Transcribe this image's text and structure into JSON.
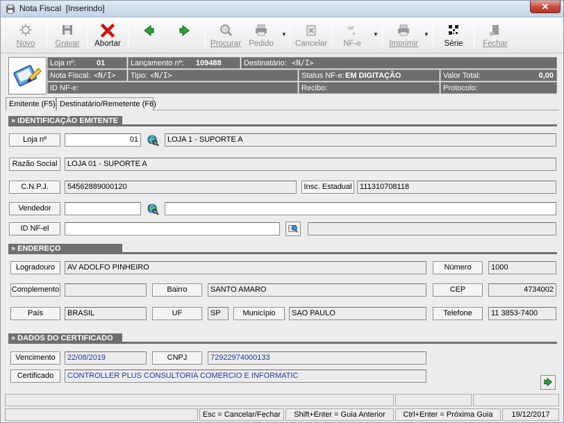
{
  "window": {
    "title": "Nota Fiscal",
    "mode": "[Inserindo]",
    "close_label": "✕"
  },
  "toolbar": {
    "novo": "Novo",
    "gravar": "Gravar",
    "abortar": "Abortar",
    "procurar": "Procurar",
    "pedido": "Pedido",
    "cancelar": "Cancelar",
    "nfe": "NF-e",
    "imprimir": "Imprimir",
    "serie": "Série",
    "fechar": "Fechar"
  },
  "header": {
    "loja_label": "Loja nº:",
    "loja_value": "01",
    "lancamento_label": "Lançamento nº:",
    "lancamento_value": "109488",
    "destinatario_label": "Destinatário:",
    "destinatario_value": "<N/I>",
    "nota_fiscal_label": "Nota Fiscal:",
    "nota_fiscal_value": "<N/I>",
    "tipo_label": "Tipo:",
    "tipo_value": "<N/I>",
    "status_label": "Status NF-e:",
    "status_value": "EM DIGITAÇÃO",
    "valor_total_label": "Valor Total:",
    "valor_total_value": "0,00",
    "id_nfe_label": "ID NF-e:",
    "recibo_label": "Recibo:",
    "protocolo_label": "Protocolo:"
  },
  "tabs": [
    {
      "label": "Emitente (F5)"
    },
    {
      "label": "Destinatário/Remetente (F6)"
    }
  ],
  "emitente": {
    "section_title": "» IDENTIFICAÇÃO EMITENTE",
    "loja_label": "Loja nº",
    "loja_value": "01",
    "loja_desc": "LOJA 1 - SUPORTE A",
    "razao_label": "Razão Social",
    "razao_value": "LOJA 01 - SUPORTE A",
    "cnpj_label": "C.N.P.J.",
    "cnpj_value": "54562889000120",
    "ie_label": "Insc. Estadual",
    "ie_value": "111310708118",
    "vendedor_label": "Vendedor",
    "vendedor_value": "",
    "vendedor_desc": "",
    "idnfe_label": "ID NF-el",
    "idnfe_value": "",
    "idnfe_desc": ""
  },
  "endereco": {
    "section_title": "» ENDEREÇO",
    "logradouro_label": "Logradouro",
    "logradouro_value": "AV ADOLFO PINHEIRO",
    "numero_label": "Número",
    "numero_value": "1000",
    "complemento_label": "Complemento",
    "complemento_value": "",
    "bairro_label": "Bairro",
    "bairro_value": "SANTO AMARO",
    "cep_label": "CEP",
    "cep_value": "4734002",
    "pais_label": "País",
    "pais_value": "BRASIL",
    "uf_label": "UF",
    "uf_value": "SP",
    "municipio_label": "Município",
    "municipio_value": "SAO PAULO",
    "telefone_label": "Telefone",
    "telefone_value": "11 3853-7400"
  },
  "certificado": {
    "section_title": "» DADOS DO CERTIFICADO",
    "vencimento_label": "Vencimento",
    "vencimento_value": "22/08/2019",
    "cnpj_label": "CNPJ",
    "cnpj_value": "72922974000133",
    "certificado_label": "Certificado",
    "certificado_value": "CONTROLLER PLUS CONSULTORIA COMERCIO E INFORMATIC"
  },
  "statusbar": {
    "esc": "Esc = Cancelar/Fechar",
    "shift_enter": "Shift+Enter = Guia Anterior",
    "ctrl_enter": "Ctrl+Enter = Próxima Guia",
    "date": "19/12/2017"
  },
  "colors": {
    "header_bg": "#6e6e6e",
    "accent_red": "#cc1111",
    "accent_green": "#1f9a2b",
    "value_blue": "#1d36a8"
  }
}
